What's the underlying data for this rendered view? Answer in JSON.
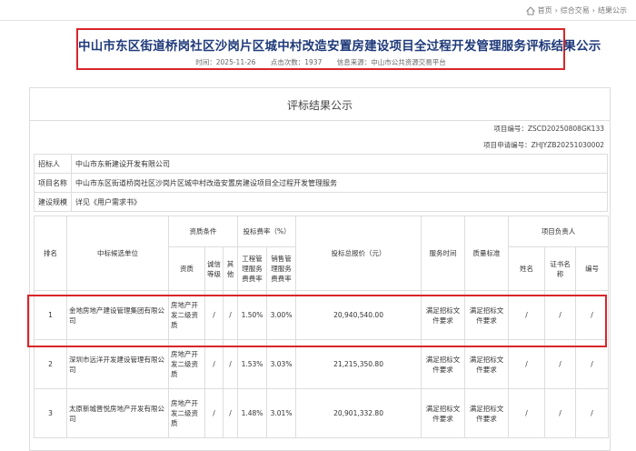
{
  "breadcrumb": {
    "home": "首页",
    "sep": "›",
    "section": "综合交易",
    "current": "结果公示"
  },
  "header": {
    "title": "中山市东区街道桥岗社区沙岗片区城中村改造安置房建设项目全过程开发管理服务评标结果公示",
    "time_label": "时间：",
    "time": "2025-11-26",
    "clicks_label": "点击次数：",
    "clicks": "1937",
    "source_label": "信息来源：",
    "source": "中山市公共资源交易平台"
  },
  "panel": {
    "title": "评标结果公示",
    "project_no_label": "项目编号：",
    "project_no": "ZSCD20250808GK133",
    "application_no_label": "项目申请编号：",
    "application_no": "ZHJYZB20251030002"
  },
  "info": {
    "tenderer_label": "招标人",
    "tenderer": "中山市东新建设开发有限公司",
    "project_label": "项目名称",
    "project": "中山市东区街道桥岗社区沙岗片区城中村改造安置房建设项目全过程开发管理服务",
    "scale_label": "建设规模",
    "scale": "详见《用户需求书》"
  },
  "table": {
    "h_rank": "排名",
    "h_company": "中标候选单位",
    "h_qual": "资质条件",
    "h_rate": "投标费率（%）",
    "h_total": "投标总报价（元）",
    "h_time": "服务时间",
    "h_quality": "质量标准",
    "h_lead": "项目负责人",
    "h_qual_sub1": "资质",
    "h_qual_sub2": "诚信等级",
    "h_qual_sub3": "其他",
    "h_rate_sub1": "工程管理服务费费率",
    "h_rate_sub2": "销售管理服务费费率",
    "h_lead_sub1": "姓名",
    "h_lead_sub2": "证书名称",
    "h_lead_sub3": "编号",
    "rows": [
      {
        "rank": "1",
        "company": "金地房地产建设管理集团有限公司",
        "qual": "房地产开发二级资质",
        "credit": "/",
        "other": "/",
        "rate1": "1.50%",
        "rate2": "3.00%",
        "total": "20,940,540.00",
        "time": "满足招标文件要求",
        "quality": "满足招标文件要求",
        "name": "/",
        "cert": "/",
        "no": "/"
      },
      {
        "rank": "2",
        "company": "深圳市远洋开发建设管理有限公司",
        "qual": "房地产开发二级资质",
        "credit": "/",
        "other": "/",
        "rate1": "1.53%",
        "rate2": "3.03%",
        "total": "21,215,350.80",
        "time": "满足招标文件要求",
        "quality": "满足招标文件要求",
        "name": "/",
        "cert": "/",
        "no": "/"
      },
      {
        "rank": "3",
        "company": "太原新城晋悦房地产开发有限公司",
        "qual": "房地产开发二级资质",
        "credit": "/",
        "other": "/",
        "rate1": "1.48%",
        "rate2": "3.01%",
        "total": "20,901,332.80",
        "time": "满足招标文件要求",
        "quality": "满足招标文件要求",
        "name": "/",
        "cert": "/",
        "no": "/"
      }
    ]
  }
}
